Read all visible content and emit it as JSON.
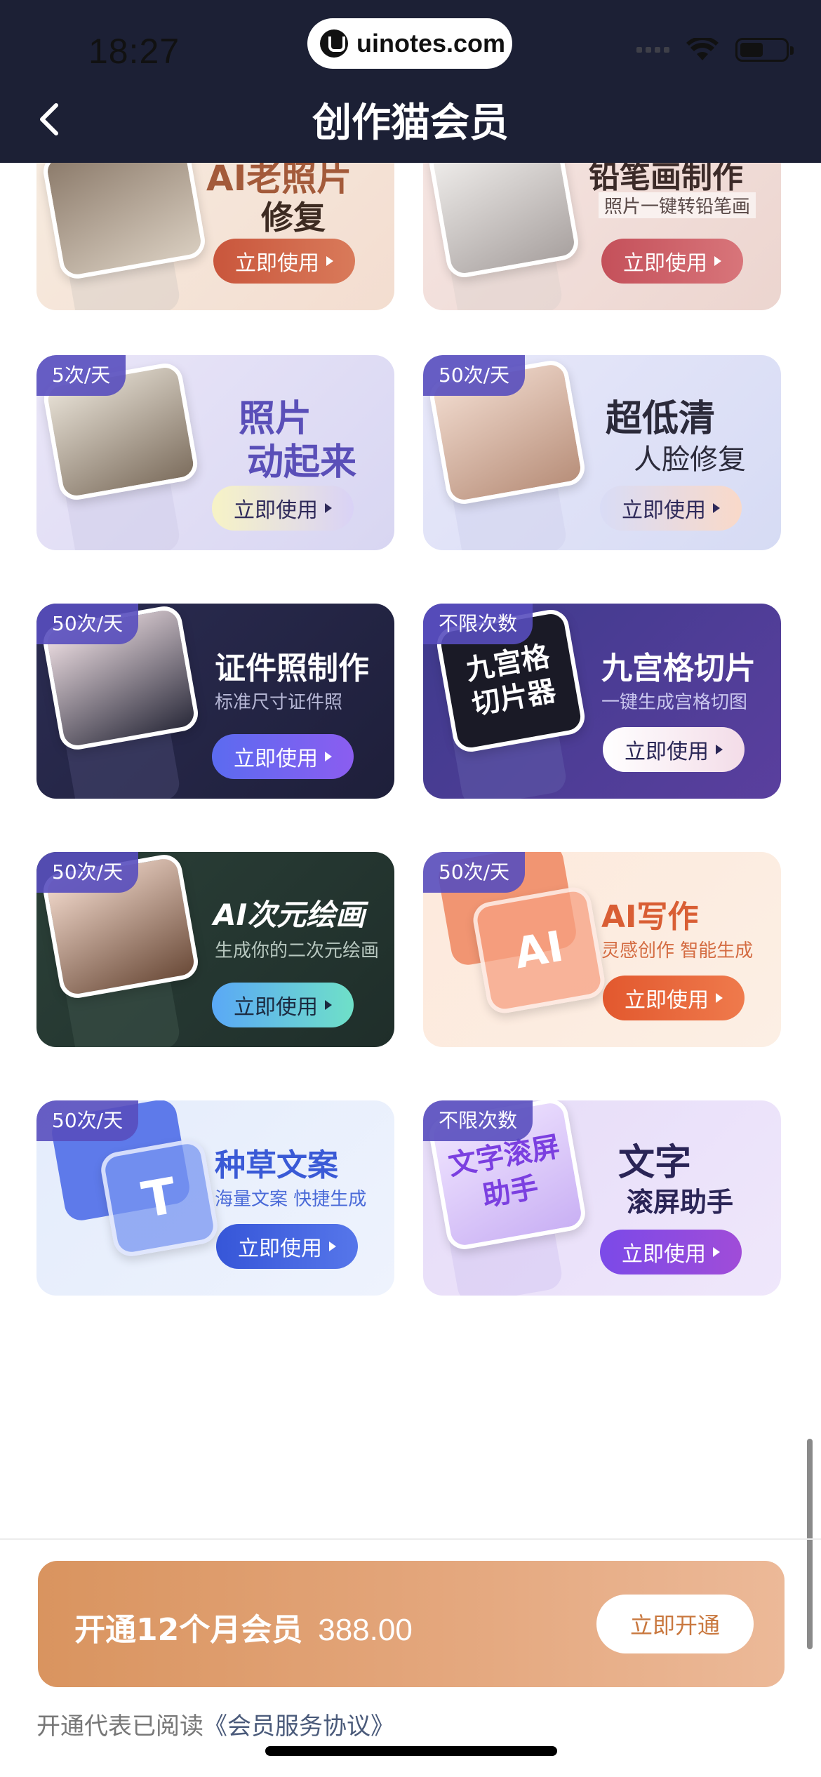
{
  "status_bar": {
    "time": "18:27",
    "url": "uinotes.com"
  },
  "header": {
    "title": "创作猫会员"
  },
  "cards": {
    "c0": {
      "title_l1": "AI老照片",
      "title_l2": "修复",
      "button": "立即使用"
    },
    "c1": {
      "title": "铅笔画制作",
      "subtitle": "照片一键转铅笔画",
      "button": "立即使用"
    },
    "c2": {
      "badge": "5次/天",
      "title_l1": "照片",
      "title_l2": "动起来",
      "button": "立即使用"
    },
    "c3": {
      "badge": "50次/天",
      "title_l1": "超低清",
      "title_l2": "人脸修复",
      "button": "立即使用"
    },
    "c4": {
      "badge": "50次/天",
      "title": "证件照制作",
      "subtitle": "标准尺寸证件照",
      "button": "立即使用"
    },
    "c5": {
      "badge": "不限次数",
      "thumb_text": "九宫格切片器",
      "title": "九宫格切片",
      "subtitle": "一键生成宫格切图",
      "button": "立即使用"
    },
    "c6": {
      "badge": "50次/天",
      "title": "AI次元绘画",
      "subtitle": "生成你的二次元绘画",
      "button": "立即使用"
    },
    "c7": {
      "badge": "50次/天",
      "thumb_text": "AI",
      "title": "AI写作",
      "subtitle": "灵感创作 智能生成",
      "button": "立即使用"
    },
    "c8": {
      "badge": "50次/天",
      "thumb_text": "T",
      "title": "种草文案",
      "subtitle": "海量文案 快捷生成",
      "button": "立即使用"
    },
    "c9": {
      "badge": "不限次数",
      "thumb_text": "文字滚屏助手",
      "title_l1": "文字",
      "title_l2": "滚屏助手",
      "button": "立即使用"
    }
  },
  "purchase": {
    "label": "开通12个月会员",
    "price": "388.00",
    "button": "立即开通"
  },
  "agreement": {
    "prefix": "开通代表已阅读",
    "link": "《会员服务协议》"
  },
  "colors": {
    "header_bg": "#1c2035",
    "buy_bar": "#e3a57a",
    "badge": "#584ebe"
  }
}
